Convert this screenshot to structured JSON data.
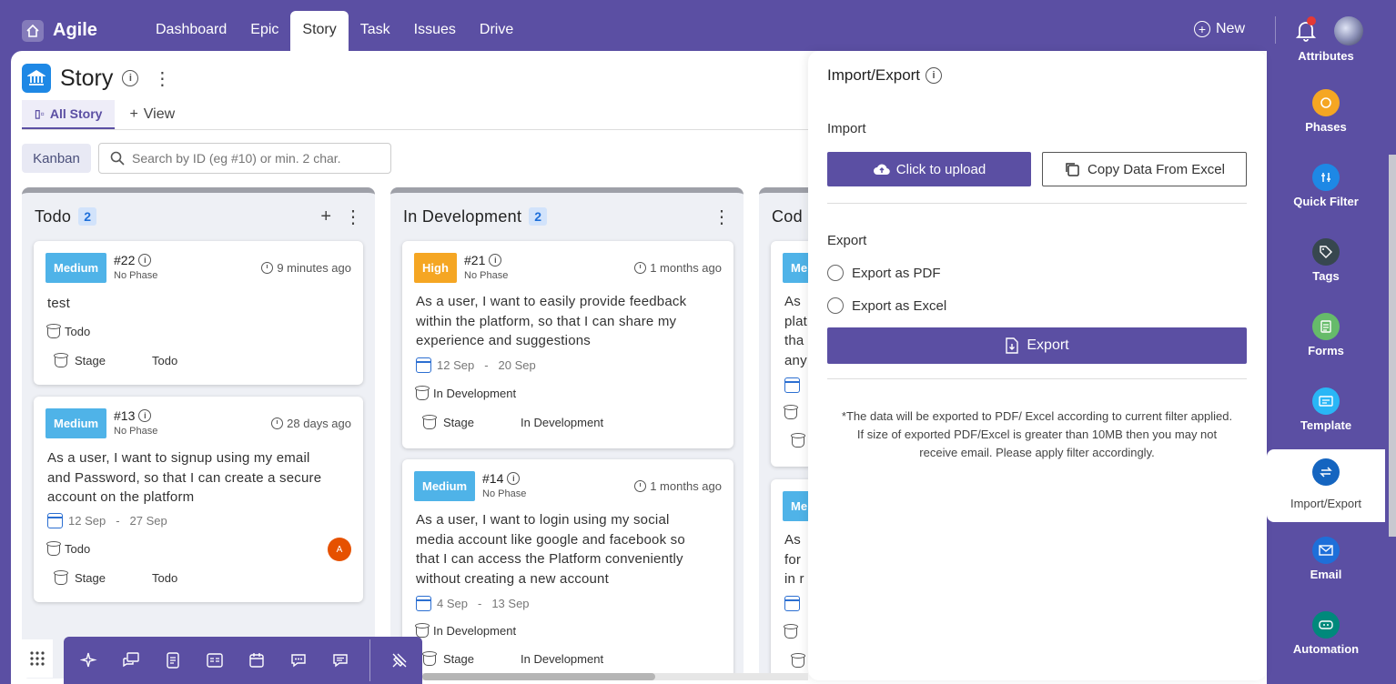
{
  "app": {
    "title": "Agile"
  },
  "nav": {
    "items": [
      {
        "label": "Dashboard"
      },
      {
        "label": "Epic"
      },
      {
        "label": "Story",
        "active": true
      },
      {
        "label": "Task"
      },
      {
        "label": "Issues"
      },
      {
        "label": "Drive"
      }
    ],
    "new_label": "New"
  },
  "page": {
    "title": "Story",
    "view_tab": "All Story",
    "add_view": "View",
    "kanban_label": "Kanban",
    "search_placeholder": "Search by ID (eg #10) or min. 2 char."
  },
  "columns": [
    {
      "title": "Todo",
      "count": "2",
      "cards": [
        {
          "priority": "Medium",
          "id": "#22",
          "phase": "No Phase",
          "time": "9 minutes ago",
          "desc": "test",
          "status": "Todo",
          "stage_label": "Stage",
          "stage_value": "Todo"
        },
        {
          "priority": "Medium",
          "id": "#13",
          "phase": "No Phase",
          "time": "28 days ago",
          "desc_lines": [
            "As a user, I want to signup using my email",
            "and Password, so that I can create a secure",
            "account on the platform"
          ],
          "start": "12 Sep",
          "end": "27 Sep",
          "status": "Todo",
          "stage_label": "Stage",
          "stage_value": "Todo",
          "assignee": "A"
        }
      ]
    },
    {
      "title": "In Development",
      "count": "2",
      "cards": [
        {
          "priority": "High",
          "id": "#21",
          "phase": "No Phase",
          "time": "1 months ago",
          "desc_lines": [
            "As a user, I want to easily provide feedback",
            "within the platform, so that I can share my",
            "experience and suggestions"
          ],
          "start": "12 Sep",
          "end": "20 Sep",
          "status": "In Development",
          "stage_label": "Stage",
          "stage_value": "In Development"
        },
        {
          "priority": "Medium",
          "id": "#14",
          "phase": "No Phase",
          "time": "1 months ago",
          "desc_lines": [
            "As a user, I want to login using my social",
            "media account like google and facebook so",
            "that I can access the Platform conveniently",
            "without creating a new account"
          ],
          "start": "4 Sep",
          "end": "13 Sep",
          "status": "In Development",
          "stage_label": "Stage",
          "stage_value": "In Development"
        }
      ]
    },
    {
      "title": "Cod",
      "cards": [
        {
          "priority": "Me",
          "desc_lines": [
            "As",
            "plat",
            "tha",
            "any"
          ]
        },
        {
          "priority": "Me",
          "desc_lines": [
            "As",
            "for",
            "in r"
          ]
        }
      ]
    }
  ],
  "date_separator": "-",
  "import_export": {
    "title": "Import/Export",
    "import_label": "Import",
    "upload_label": "Click to upload",
    "copy_label": "Copy Data From Excel",
    "export_label": "Export",
    "pdf_option": "Export as PDF",
    "excel_option": "Export as Excel",
    "export_button": "Export",
    "note_lines": [
      "*The data will be exported to PDF/ Excel according to current filter applied.",
      "If size of exported PDF/Excel is greater than 10MB then you may not",
      "receive email. Please apply filter accordingly."
    ]
  },
  "sidebar": {
    "attributes_label": "Attributes",
    "items": [
      {
        "label": "Phases",
        "color": "#f5a623"
      },
      {
        "label": "Quick Filter",
        "color": "#1e88e5"
      },
      {
        "label": "Tags",
        "color": "#37474f"
      },
      {
        "label": "Forms",
        "color": "#66bb6a"
      },
      {
        "label": "Template",
        "color": "#29b6f6"
      },
      {
        "label": "Import/Export",
        "color": "#1565c0"
      },
      {
        "label": "Email",
        "color": "#1e6fd9"
      },
      {
        "label": "Automation",
        "color": "#00897b"
      }
    ]
  },
  "colors": {
    "accent": "#5b4fa3",
    "medium": "#4fb3e8",
    "high": "#f5a623"
  }
}
